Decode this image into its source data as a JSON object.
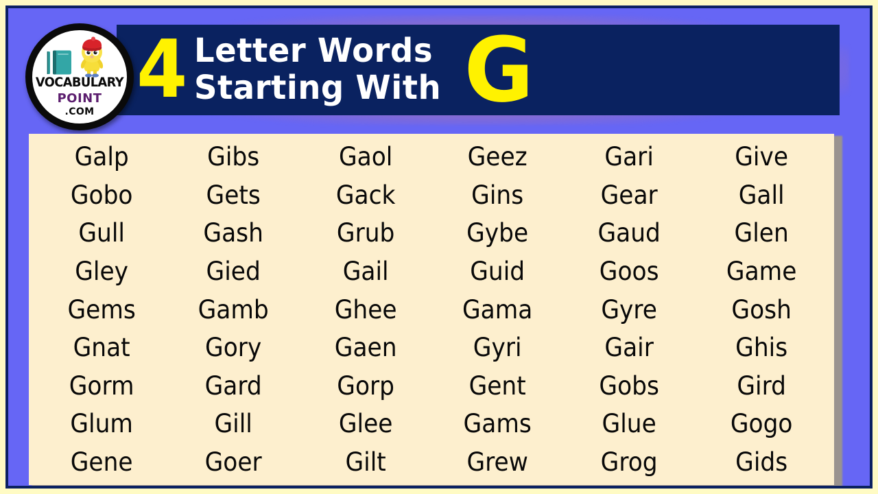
{
  "theme": {
    "outer_border": "#FFFBC4",
    "frame_border": "#0B2161",
    "background": "#6666F5",
    "header_panel": "#0A2260",
    "header_glow": "#B06EA0",
    "accent_yellow": "#FFF200",
    "title_white": "#FFFFFF",
    "card_background": "#FDEFCE",
    "card_shadow": "#9A938F",
    "word_text": "#080808",
    "logo_purple": "#5B1D6E",
    "logo_ring": "#0A0A0A",
    "mascot_yellow": "#F7DE3A",
    "mascot_hat_red": "#D8232A",
    "book_teal": "#2E9B9B"
  },
  "header": {
    "number": "4",
    "title_line_1": "Letter Words",
    "title_line_2": "Starting With",
    "letter": "G"
  },
  "logo": {
    "name_line_1": "VOCABULARY",
    "name_line_2": "POINT",
    "name_line_3": ".COM"
  },
  "words": {
    "columns": 6,
    "rows": [
      [
        "Galp",
        "Gibs",
        "Gaol",
        "Geez",
        "Gari",
        "Give"
      ],
      [
        "Gobo",
        "Gets",
        "Gack",
        "Gins",
        "Gear",
        "Gall"
      ],
      [
        "Gull",
        "Gash",
        "Grub",
        "Gybe",
        "Gaud",
        "Glen"
      ],
      [
        "Gley",
        "Gied",
        "Gail",
        "Guid",
        "Goos",
        "Game"
      ],
      [
        "Gems",
        "Gamb",
        "Ghee",
        "Gama",
        "Gyre",
        "Gosh"
      ],
      [
        "Gnat",
        "Gory",
        "Gaen",
        "Gyri",
        "Gair",
        "Ghis"
      ],
      [
        "Gorm",
        "Gard",
        "Gorp",
        "Gent",
        "Gobs",
        "Gird"
      ],
      [
        "Glum",
        "Gill",
        "Glee",
        "Gams",
        "Glue",
        "Gogo"
      ],
      [
        "Gene",
        "Goer",
        "Gilt",
        "Grew",
        "Grog",
        "Gids"
      ]
    ]
  }
}
